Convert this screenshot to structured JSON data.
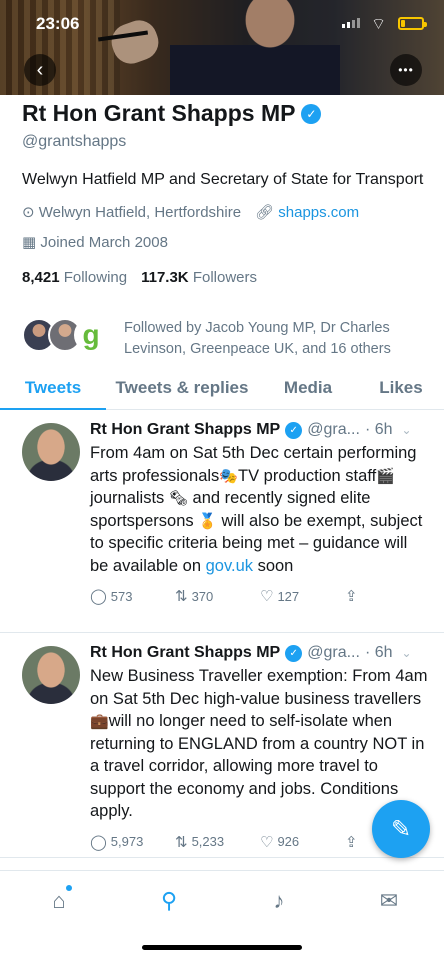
{
  "status_bar": {
    "time": "23:06",
    "battery_level": 0.2
  },
  "profile": {
    "name": "Rt Hon Grant Shapps MP",
    "handle": "@grantshapps",
    "bio": "Welwyn Hatfield MP and Secretary of State for Transport",
    "location": "Welwyn Hatfield, Hertfordshire",
    "website": "shapps.com",
    "joined": "Joined March 2008",
    "following_count": "8,421",
    "following_label": "Following",
    "followers_count": "117.3K",
    "followers_label": "Followers",
    "followed_by_line1": "Followed by Jacob Young MP, Dr Charles",
    "followed_by_line2": "Levinson, Greenpeace UK, and 16 others"
  },
  "tabs": [
    {
      "label": "Tweets",
      "active": true
    },
    {
      "label": "Tweets & replies",
      "active": false
    },
    {
      "label": "Media",
      "active": false
    },
    {
      "label": "Likes",
      "active": false
    }
  ],
  "tweets": [
    {
      "author": "Rt Hon Grant Shapps MP",
      "handle": "@gra...",
      "time": "· 6h",
      "text_1": "From 4am on Sat 5th Dec certain performing arts professionals",
      "emoji_1": "🎭",
      "text_2": "TV production staff",
      "emoji_2": "🎬",
      "text_3": "journalists",
      "emoji_3": "🗞",
      "text_4": " and recently signed elite sportspersons",
      "emoji_4": "🏅",
      "text_5": " will also be exempt, subject to specific criteria being met – guidance will be available on",
      "link": "gov.uk",
      "text_6": " soon",
      "replies": "573",
      "retweets": "370",
      "likes": "127"
    },
    {
      "author": "Rt Hon Grant Shapps MP",
      "handle": "@gra...",
      "time": "· 6h",
      "text_1": "New Business Traveller exemption: From 4am on Sat 5th Dec high-value business travellers",
      "emoji_1": "💼",
      "text_2": "will no longer need to self-isolate when returning to ENGLAND from a country NOT in a travel corridor, allowing more travel to support the economy and jobs. Conditions apply.",
      "replies": "5,973",
      "retweets": "5,233",
      "likes": "926"
    }
  ],
  "colors": {
    "accent": "#1da1f2",
    "secondary_text": "#657786"
  }
}
